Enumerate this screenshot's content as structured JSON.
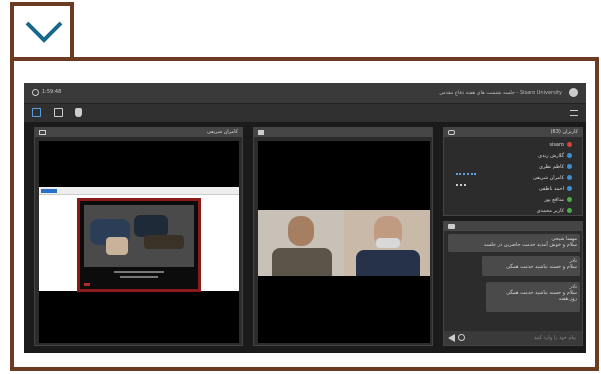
{
  "window": {
    "timer": "1:59:48",
    "title": "Sisaro University - جلسه نشست های هفته دفاع مقدس"
  },
  "panes": {
    "camera_label": "کامران شریفی",
    "users_label": "کاربران (63)",
    "users": [
      {
        "name": "sisaro",
        "color": "#d9423a"
      },
      {
        "name": "گلارش زندی",
        "color": "#3b8fd6"
      },
      {
        "name": "کاظم نظری",
        "color": "#3b8fd6"
      },
      {
        "name": "کامران شریفی",
        "color": "#3b8fd6"
      },
      {
        "name": "احمد ناطقی",
        "color": "#3b8fd6"
      },
      {
        "name": "مدافع پور",
        "color": "#46b046"
      },
      {
        "name": "کاربر محمدی",
        "color": "#46b046"
      }
    ],
    "chat_messages": [
      {
        "author": "مهسا شیخی",
        "text": "سلام و خوش آمدید خدمت حاضرین در جلسه"
      },
      {
        "author": "نادر",
        "text": "سلام و خسته نباشید خدمت همگی"
      },
      {
        "author": "نادر",
        "text": "سلام و خسته نباشید خدمت همگی"
      }
    ],
    "chat_tail": "روز.هفته",
    "chat_placeholder": "پیام خود را وارد کنید"
  },
  "accent_color": "#15698c",
  "frame_color": "#6b3b22"
}
